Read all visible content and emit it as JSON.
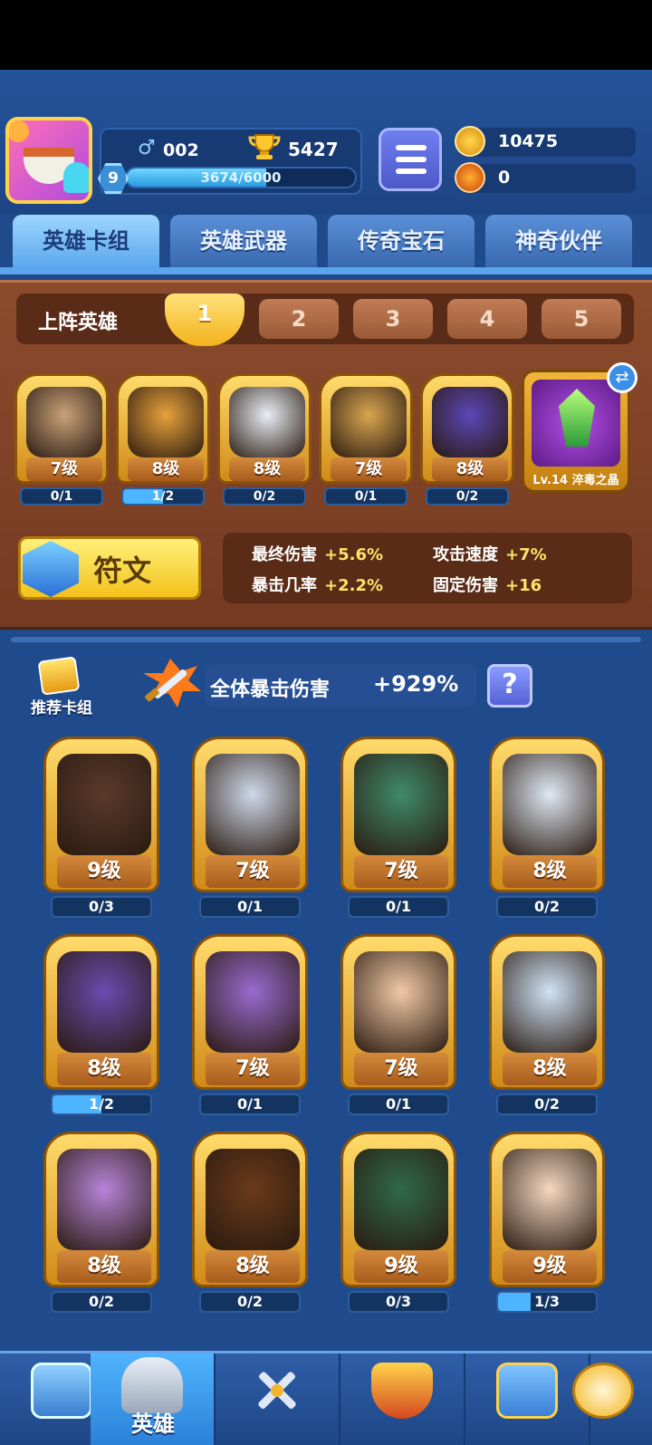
{
  "profile": {
    "gender_icon": "male-icon",
    "gender_value": "002",
    "trophies": "5427",
    "level": "9",
    "xp_text": "3674/6000",
    "xp_progress": 0.612
  },
  "currency": {
    "gold": "10475",
    "gems": "0"
  },
  "tabs": [
    {
      "label": "英雄卡组",
      "active": true
    },
    {
      "label": "英雄武器",
      "active": false
    },
    {
      "label": "传奇宝石",
      "active": false
    },
    {
      "label": "神奇伙伴",
      "active": false
    }
  ],
  "lineup": {
    "label": "上阵英雄",
    "decks": [
      "1",
      "2",
      "3",
      "4",
      "5"
    ],
    "active_deck": "1",
    "heroes": [
      {
        "level": "7级",
        "count": "0/1",
        "progress": 0,
        "color": "#c9a27a"
      },
      {
        "level": "8级",
        "count": "1/2",
        "progress": 0.5,
        "color": "#e8a23a"
      },
      {
        "level": "8级",
        "count": "0/2",
        "progress": 0,
        "color": "#e9eef6"
      },
      {
        "level": "7级",
        "count": "0/1",
        "progress": 0,
        "color": "#d9a650"
      },
      {
        "level": "8级",
        "count": "0/2",
        "progress": 0,
        "color": "#5b47b8"
      }
    ],
    "artifact_label": "Lv.14 淬毒之晶"
  },
  "rune": {
    "label": "符文",
    "stats": [
      {
        "name": "最终伤害",
        "value": "+5.6%"
      },
      {
        "name": "攻击速度",
        "value": "+7%"
      },
      {
        "name": "暴击几率",
        "value": "+2.2%"
      },
      {
        "name": "固定伤害",
        "value": "+16"
      }
    ]
  },
  "deck": {
    "recommend_label": "推荐卡组",
    "crit_label": "全体暴击伤害",
    "crit_value": "+929%",
    "help_label": "?",
    "heroes": [
      {
        "level": "9级",
        "count": "0/3",
        "progress": 0,
        "color": "#5a3a2a"
      },
      {
        "level": "7级",
        "count": "0/1",
        "progress": 0,
        "color": "#cfd9ea"
      },
      {
        "level": "7级",
        "count": "0/1",
        "progress": 0,
        "color": "#3f8a6a"
      },
      {
        "level": "8级",
        "count": "0/2",
        "progress": 0,
        "color": "#dfe9f5"
      },
      {
        "level": "8级",
        "count": "1/2",
        "progress": 0.5,
        "color": "#6a4bb0"
      },
      {
        "level": "7级",
        "count": "0/1",
        "progress": 0,
        "color": "#9a6ad0"
      },
      {
        "level": "7级",
        "count": "0/1",
        "progress": 0,
        "color": "#f1c9a6"
      },
      {
        "level": "8级",
        "count": "0/2",
        "progress": 0,
        "color": "#cfe3f7"
      },
      {
        "level": "8级",
        "count": "0/2",
        "progress": 0,
        "color": "#b684d8"
      },
      {
        "level": "8级",
        "count": "0/2",
        "progress": 0,
        "color": "#6a3a1a"
      },
      {
        "level": "9级",
        "count": "0/3",
        "progress": 0,
        "color": "#2f6a4a"
      },
      {
        "level": "9级",
        "count": "1/3",
        "progress": 0.33,
        "color": "#f5d8c0"
      }
    ]
  },
  "nav": [
    {
      "label": "",
      "icon": "treasure-chest-icon",
      "active": false
    },
    {
      "label": "英雄",
      "icon": "knight-helmet-icon",
      "active": true
    },
    {
      "label": "",
      "icon": "crossed-swords-icon",
      "active": false
    },
    {
      "label": "",
      "icon": "crown-shield-icon",
      "active": false
    },
    {
      "label": "",
      "icon": "friends-icon",
      "active": false
    },
    {
      "label": "",
      "icon": "compass-icon",
      "active": false
    }
  ]
}
